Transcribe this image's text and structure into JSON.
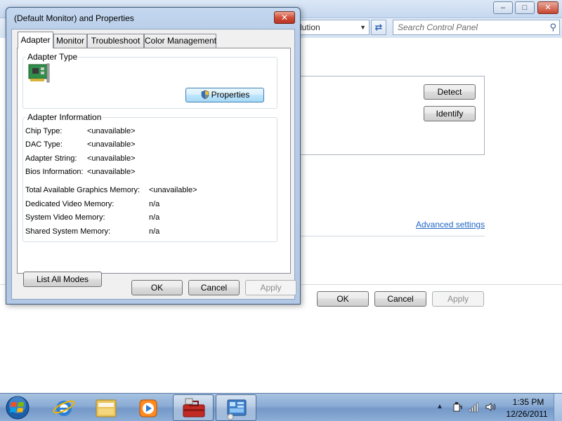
{
  "background_window": {
    "address_text": "lution",
    "search_placeholder": "Search Control Panel",
    "caption": {
      "minimize": "–",
      "maximize": "□",
      "close": "✕"
    },
    "refresh_glyph": "⇄",
    "buttons": {
      "detect": "Detect",
      "identify": "Identify",
      "ok": "OK",
      "cancel": "Cancel",
      "apply": "Apply"
    },
    "advanced_link": "Advanced settings"
  },
  "dialog": {
    "title": "(Default Monitor) and  Properties",
    "close_glyph": "✕",
    "tabs": [
      {
        "label": "Adapter",
        "active": true
      },
      {
        "label": "Monitor",
        "active": false
      },
      {
        "label": "Troubleshoot",
        "active": false
      },
      {
        "label": "Color Management",
        "active": false
      }
    ],
    "adapter_type": {
      "group_label": "Adapter Type",
      "properties_button": "Properties"
    },
    "adapter_info": {
      "group_label": "Adapter Information",
      "rows": [
        {
          "label": "Chip Type:",
          "value": "<unavailable>"
        },
        {
          "label": "DAC Type:",
          "value": "<unavailable>"
        },
        {
          "label": "Adapter String:",
          "value": "<unavailable>"
        },
        {
          "label": "Bios Information:",
          "value": "<unavailable>"
        }
      ],
      "memory_rows": [
        {
          "label": "Total Available Graphics Memory:",
          "value": "<unavailable>"
        },
        {
          "label": "Dedicated Video Memory:",
          "value": "n/a"
        },
        {
          "label": "System Video Memory:",
          "value": "n/a"
        },
        {
          "label": "Shared System Memory:",
          "value": "n/a"
        }
      ]
    },
    "list_all_modes_button": "List All Modes",
    "buttons": {
      "ok": "OK",
      "cancel": "Cancel",
      "apply": "Apply"
    }
  },
  "taskbar": {
    "clock_time": "1:35 PM",
    "clock_date": "12/26/2011",
    "tray_up_glyph": "▲"
  },
  "colors": {
    "link": "#1f66c4",
    "dialog_frame": "#b9cde8",
    "taskbar": "#8aabd4"
  }
}
